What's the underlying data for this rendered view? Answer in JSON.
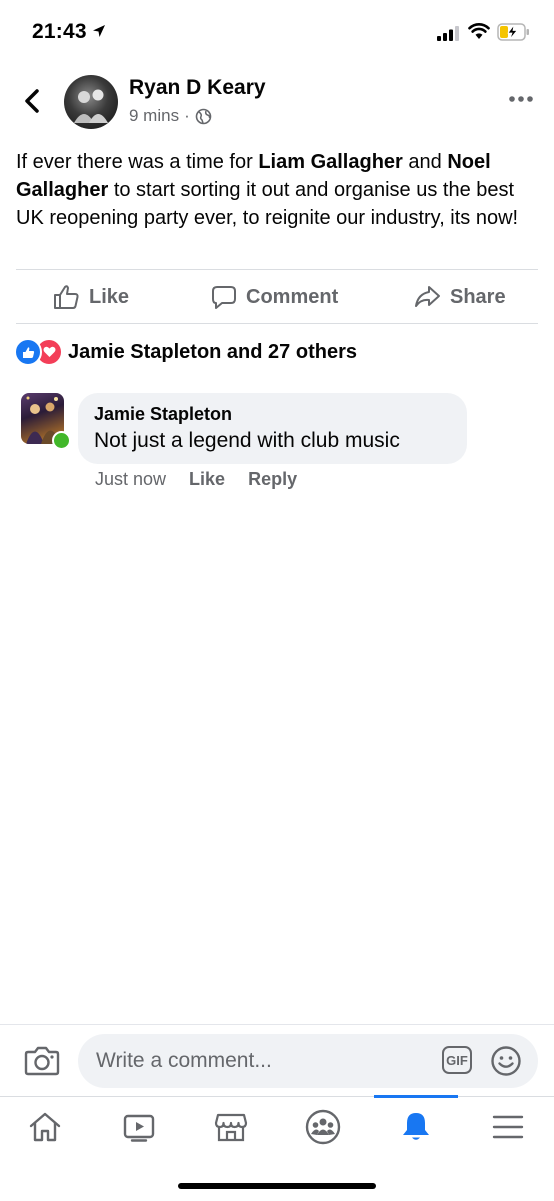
{
  "status_bar": {
    "time": "21:43"
  },
  "post": {
    "author": "Ryan D Keary",
    "time_ago": "9 mins",
    "separator": "·",
    "text_parts": [
      {
        "text": "If ever there was a time for ",
        "bold": false
      },
      {
        "text": "Liam Gallagher",
        "bold": true
      },
      {
        "text": " and ",
        "bold": false
      },
      {
        "text": "Noel Gallagher",
        "bold": true
      },
      {
        "text": " to start sorting it out and organise us the best UK reopening party ever, to reignite our industry, its now!",
        "bold": false
      }
    ]
  },
  "actions": {
    "like": "Like",
    "comment": "Comment",
    "share": "Share"
  },
  "reactions": {
    "summary": "Jamie Stapleton and 27 others"
  },
  "comment": {
    "author": "Jamie Stapleton",
    "text": "Not just a legend with club music",
    "time": "Just now",
    "like_label": "Like",
    "reply_label": "Reply"
  },
  "composer": {
    "placeholder": "Write a comment...",
    "gif_label": "GIF"
  },
  "tabs": [
    {
      "name": "home",
      "icon": "home-icon",
      "active": false
    },
    {
      "name": "watch",
      "icon": "video-icon",
      "active": false
    },
    {
      "name": "marketplace",
      "icon": "store-icon",
      "active": false
    },
    {
      "name": "groups",
      "icon": "groups-icon",
      "active": false
    },
    {
      "name": "notifications",
      "icon": "bell-icon",
      "active": true
    },
    {
      "name": "menu",
      "icon": "menu-icon",
      "active": false
    }
  ],
  "colors": {
    "accent": "#1877f2",
    "love": "#f33e58",
    "online": "#42b72a",
    "secondary_text": "#65676b"
  }
}
